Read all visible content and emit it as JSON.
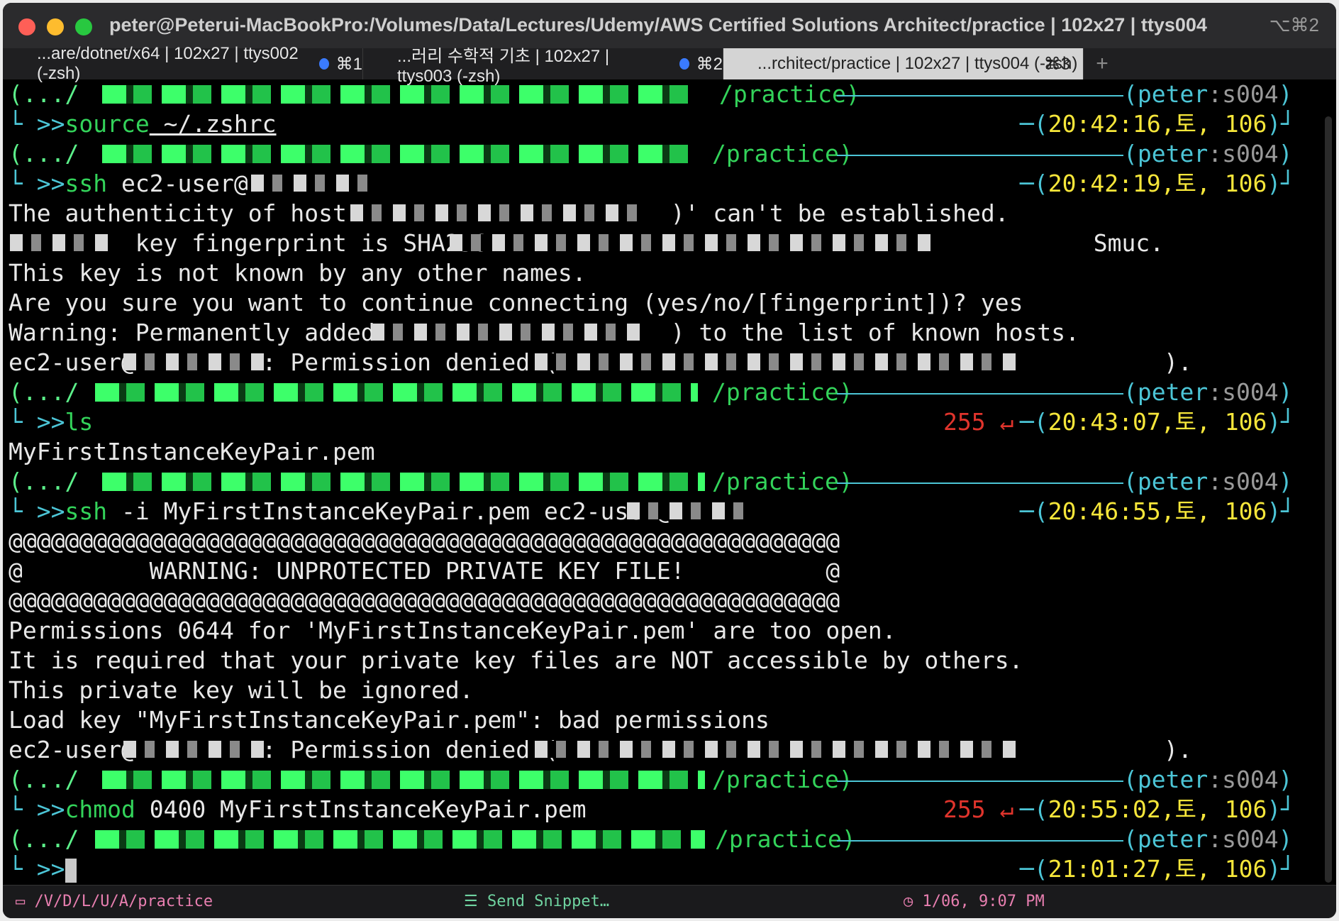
{
  "window": {
    "title": "peter@Peterui-MacBookPro:/Volumes/Data/Lectures/Udemy/AWS Certified Solutions Architect/practice | 102x27 | ttys004",
    "shortcut": "⌥⌘2"
  },
  "tabs": [
    {
      "label": "...are/dotnet/x64 | 102x27 | ttys002 (-zsh)",
      "key": "⌘1"
    },
    {
      "label": "...러리 수학적 기초 | 102x27 | ttys003 (-zsh)",
      "key": "⌘2"
    },
    {
      "label": "...rchitect/practice | 102x27 | ttys004 (-zsh)",
      "key": "⌘3"
    }
  ],
  "new_tab": "+",
  "prompt": {
    "dir_prefix": "(.../",
    "dir_suffix": "/practice)",
    "user": "peter",
    "session": "s004",
    "arrow": ">>",
    "date": "토",
    "hist": "106"
  },
  "blocks": [
    {
      "cmd": "source",
      "args": " ~/.zshrc",
      "time": "20:42:16",
      "err": ""
    },
    {
      "cmd": "ssh",
      "args": " ec2-user@",
      "time": "20:42:19",
      "err": ""
    },
    {
      "cmd": "ls",
      "args": "",
      "time": "20:43:07",
      "err": "255 ↵"
    },
    {
      "cmd": "ssh",
      "args": " -i MyFirstInstanceKeyPair.pem ec2-user@",
      "time": "20:46:55",
      "err": ""
    },
    {
      "cmd": "chmod",
      "args": " 0400 MyFirstInstanceKeyPair.pem",
      "time": "20:55:02",
      "err": "255 ↵"
    },
    {
      "cmd": "",
      "args": "",
      "time": "21:01:27",
      "err": ""
    }
  ],
  "output": {
    "o1": "The authenticity of host '                     )' can't be established.",
    "o2": "         key fingerprint is SHA256:                                          Smuc.",
    "o3": "This key is not known by any other names.",
    "o4": "Are you sure you want to continue connecting (yes/no/[fingerprint])? yes",
    "o5": "Warning: Permanently added '                   ) to the list of known hosts.",
    "o6": "ec2-user@         : Permission denied (                                           ).",
    "o7": "MyFirstInstanceKeyPair.pem",
    "o8": "@@@@@@@@@@@@@@@@@@@@@@@@@@@@@@@@@@@@@@@@@@@@@@@@@@@@@@@@@@@",
    "o9": "@         WARNING: UNPROTECTED PRIVATE KEY FILE!          @",
    "o10": "@@@@@@@@@@@@@@@@@@@@@@@@@@@@@@@@@@@@@@@@@@@@@@@@@@@@@@@@@@@",
    "o11": "Permissions 0644 for 'MyFirstInstanceKeyPair.pem' are too open.",
    "o12": "It is required that your private key files are NOT accessible by others.",
    "o13": "This private key will be ignored.",
    "o14": "Load key \"MyFirstInstanceKeyPair.pem\": bad permissions",
    "o15": "ec2-user@         : Permission denied (                                           )."
  },
  "statusbar": {
    "path": "/V/D/L/U/A/practice",
    "snippet": "Send Snippet…",
    "clock": "1/06, 9:07 PM"
  },
  "colors": {
    "green": "#33d35a",
    "cyan": "#4cc5d6",
    "yellow": "#f6e63a",
    "red": "#e0342c",
    "purple": "#a78bfa"
  }
}
